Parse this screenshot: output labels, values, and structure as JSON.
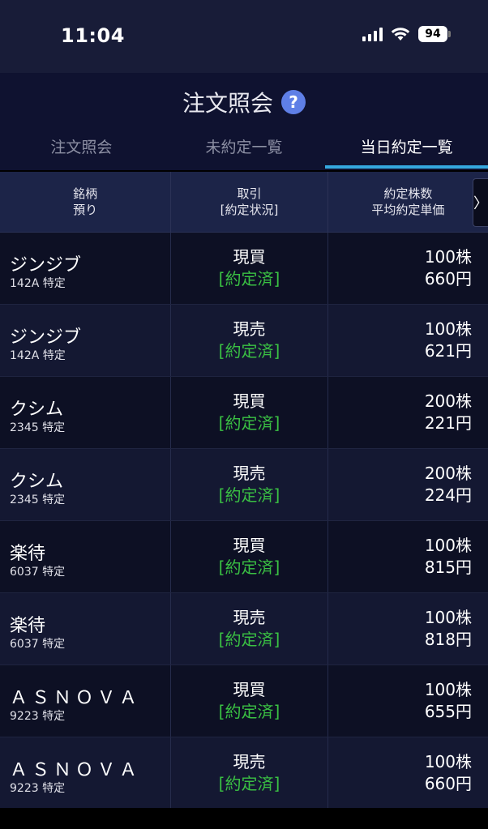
{
  "status_bar": {
    "time": "11:04",
    "battery": "94"
  },
  "header": {
    "title": "注文照会",
    "help_icon": "?"
  },
  "tabs": [
    {
      "label": "注文照会"
    },
    {
      "label": "未約定一覧"
    },
    {
      "label": "当日約定一覧"
    }
  ],
  "active_tab": "当日約定一覧",
  "table": {
    "headers": {
      "col1_line1": "銘柄",
      "col1_line2": "預り",
      "col2_line1": "取引",
      "col2_line2": "[約定状況]",
      "col3_line1": "約定株数",
      "col3_line2": "平均約定単価"
    },
    "scroll_glyph": "〉",
    "rows": [
      {
        "name": "ジンジブ",
        "code": "142A 特定",
        "trade": "現買",
        "status": "[約定済]",
        "qty": "100株",
        "price": "660円"
      },
      {
        "name": "ジンジブ",
        "code": "142A 特定",
        "trade": "現売",
        "status": "[約定済]",
        "qty": "100株",
        "price": "621円"
      },
      {
        "name": "クシム",
        "code": "2345 特定",
        "trade": "現買",
        "status": "[約定済]",
        "qty": "200株",
        "price": "221円"
      },
      {
        "name": "クシム",
        "code": "2345 特定",
        "trade": "現売",
        "status": "[約定済]",
        "qty": "200株",
        "price": "224円"
      },
      {
        "name": "楽待",
        "code": "6037 特定",
        "trade": "現買",
        "status": "[約定済]",
        "qty": "100株",
        "price": "815円"
      },
      {
        "name": "楽待",
        "code": "6037 特定",
        "trade": "現売",
        "status": "[約定済]",
        "qty": "100株",
        "price": "818円"
      },
      {
        "name": "ＡＳＮＯＶＡ",
        "code": "9223 特定",
        "trade": "現買",
        "status": "[約定済]",
        "qty": "100株",
        "price": "655円"
      },
      {
        "name": "ＡＳＮＯＶＡ",
        "code": "9223 特定",
        "trade": "現売",
        "status": "[約定済]",
        "qty": "100株",
        "price": "660円"
      }
    ]
  },
  "colors": {
    "status_green": "#3ac043",
    "tab_accent": "#35a8df",
    "help_blue": "#5f7fe6"
  }
}
